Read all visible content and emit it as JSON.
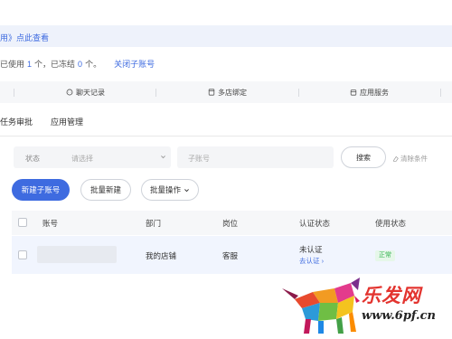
{
  "notice": {
    "text": "用》点此查看"
  },
  "usage": {
    "prefix": "已使用",
    "used": "1",
    "mid": "个，已冻结",
    "frozen": "0",
    "suffix": "个。",
    "close_link": "关闭子账号"
  },
  "navbar": {
    "items": [
      {
        "label": "聊天记录",
        "icon": "chat-icon"
      },
      {
        "label": "多店绑定",
        "icon": "store-icon"
      },
      {
        "label": "应用服务",
        "icon": "calendar-icon"
      }
    ]
  },
  "tabs": [
    "任务审批",
    "应用管理"
  ],
  "filter": {
    "status_label": "状态",
    "status_placeholder": "请选择",
    "account_placeholder": "子账号",
    "search_label": "搜索",
    "clear_label": "清除条件"
  },
  "actions": {
    "new_label": "新建子账号",
    "batch_new_label": "批量新建",
    "batch_ops_label": "批量操作"
  },
  "table": {
    "columns": [
      "账号",
      "部门",
      "岗位",
      "认证状态",
      "使用状态"
    ],
    "rows": [
      {
        "account": "",
        "department": "我的店铺",
        "position": "客服",
        "auth_status": "未认证",
        "auth_link": "去认证",
        "use_status": "正常"
      }
    ]
  },
  "watermark": {
    "name": "乐发网",
    "url": "www.6pf.cn"
  },
  "colors": {
    "accent": "#3e6be0",
    "success": "#34b34f",
    "brand_red": "#e3342f"
  }
}
